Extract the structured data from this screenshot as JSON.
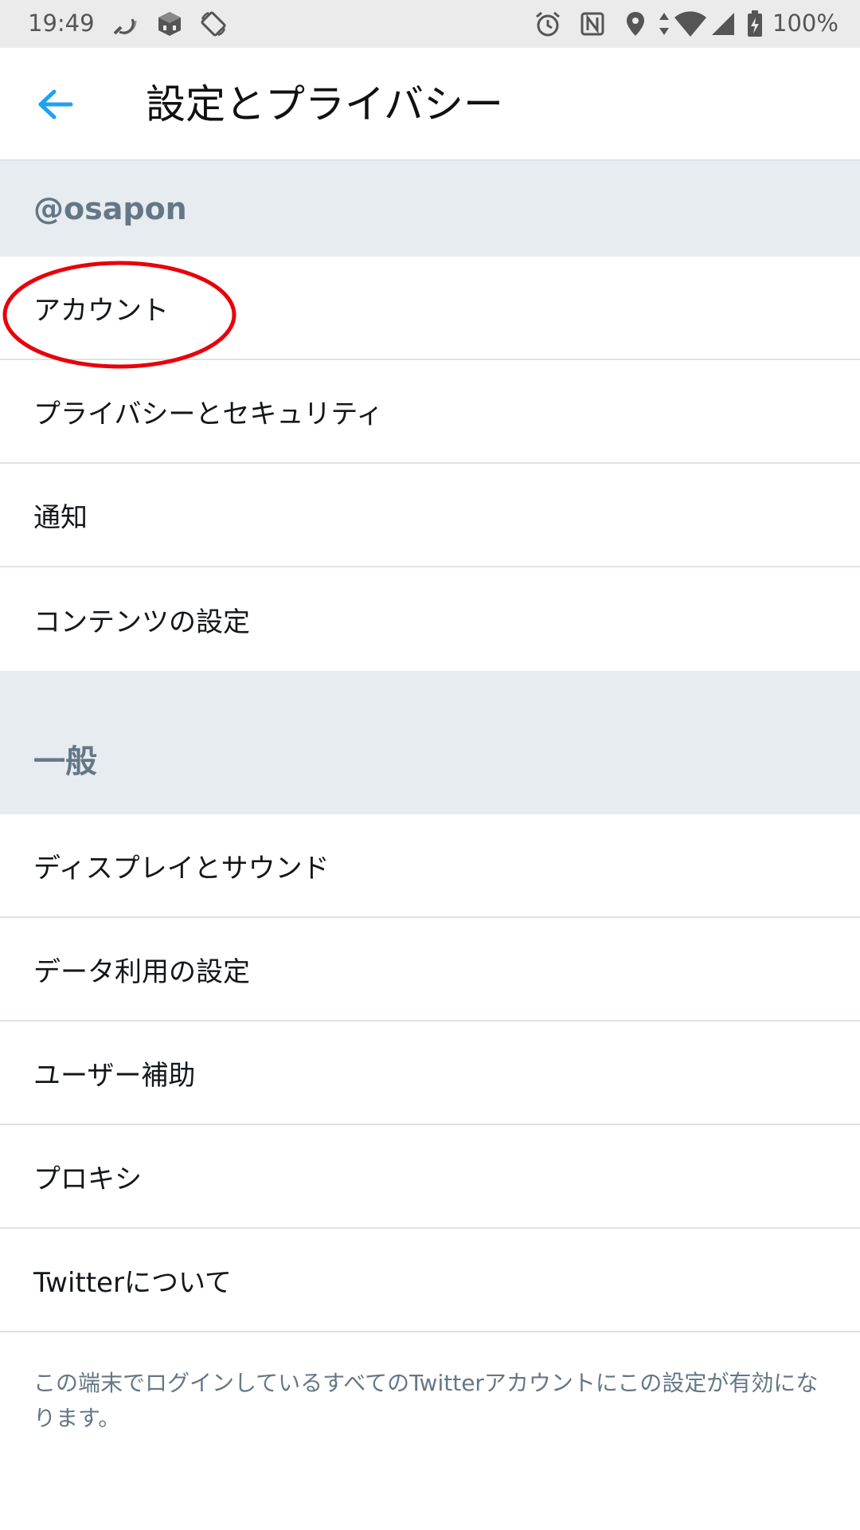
{
  "status_bar": {
    "time": "19:49",
    "battery": "100%",
    "icons": [
      "nfc-signal-icon",
      "app-icon",
      "screen-rotate-icon",
      "alarm-icon",
      "nfc-icon",
      "location-icon",
      "data-arrows-icon",
      "wifi-icon",
      "cell-signal-icon",
      "battery-icon"
    ]
  },
  "header": {
    "title": "設定とプライバシー",
    "back_icon": "back-arrow-icon",
    "accent_color": "#1da1f2"
  },
  "sections": [
    {
      "title": "@osapon",
      "items": [
        {
          "label": "アカウント"
        },
        {
          "label": "プライバシーとセキュリティ"
        },
        {
          "label": "通知"
        },
        {
          "label": "コンテンツの設定"
        }
      ]
    },
    {
      "title": "一般",
      "items": [
        {
          "label": "ディスプレイとサウンド"
        },
        {
          "label": "データ利用の設定"
        },
        {
          "label": "ユーザー補助"
        },
        {
          "label": "プロキシ"
        },
        {
          "label": "Twitterについて"
        }
      ]
    }
  ],
  "footer": {
    "note": "この端末でログインしているすべてのTwitterアカウントにこの設定が有効になります。"
  },
  "colors": {
    "section_bg": "#e6ecf0",
    "section_text": "#657786",
    "annotation_red": "#e8000b"
  }
}
